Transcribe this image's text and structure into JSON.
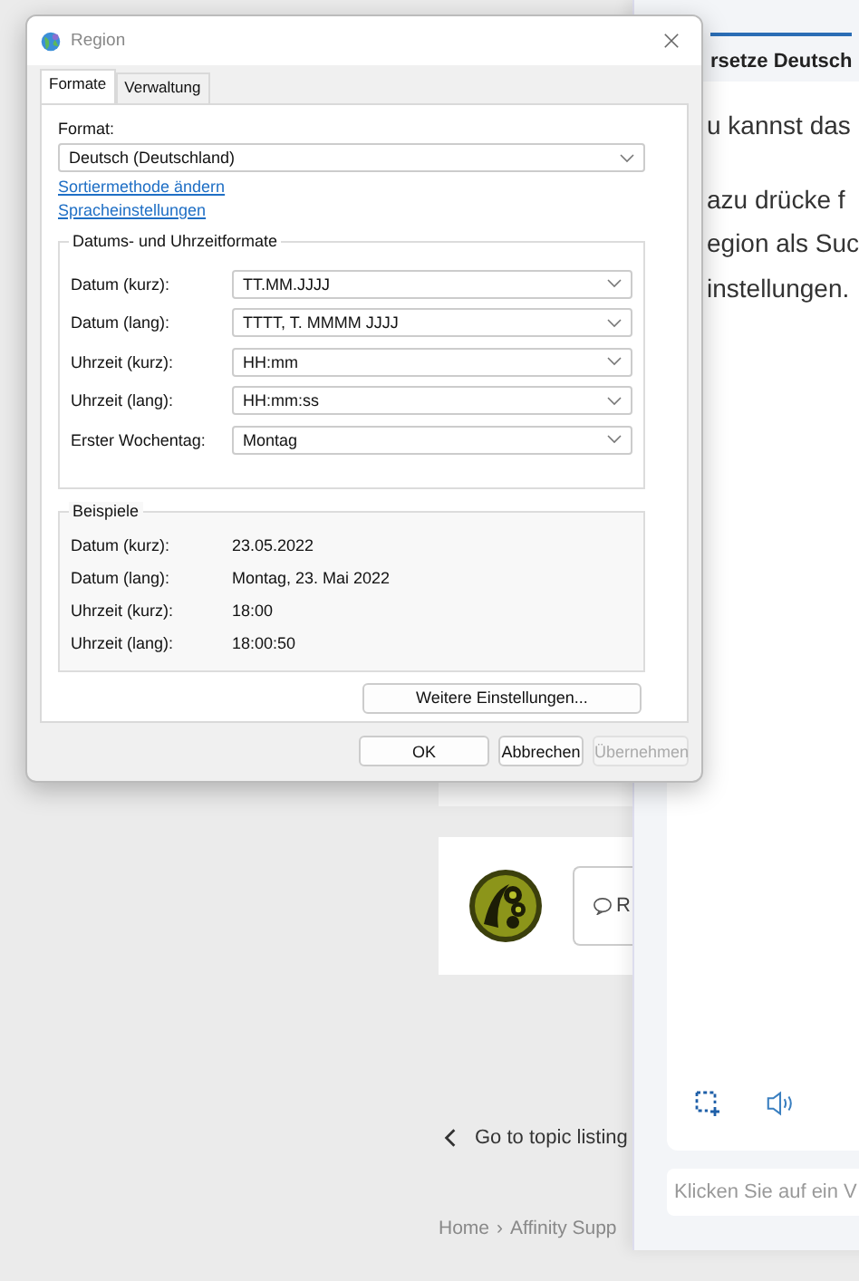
{
  "background_page": {
    "reply_label": "R",
    "back_link": "Go to topic listing",
    "breadcrumb": {
      "items": [
        "Home",
        "Affinity Supp"
      ],
      "separator": "›"
    }
  },
  "translator_panel": {
    "tab_label": "rsetze Deutsch",
    "paragraphs": [
      [
        "u kannst das"
      ],
      [
        "azu drücke f",
        "egion als Suc",
        "instellungen."
      ]
    ],
    "input": {
      "placeholder": "Klicken Sie auf ein V"
    }
  },
  "dialog": {
    "title": "Region",
    "tabs": [
      {
        "label": "Formate",
        "selected": true
      },
      {
        "label": "Verwaltung",
        "selected": false
      }
    ],
    "format_label": "Format:",
    "format_value": "Deutsch (Deutschland)",
    "links": [
      "Sortiermethode ändern",
      "Spracheinstellungen"
    ],
    "formats_group": {
      "title": "Datums- und Uhrzeitformate",
      "rows": [
        {
          "label": "Datum (kurz):",
          "value": "TT.MM.JJJJ"
        },
        {
          "label": "Datum (lang):",
          "value": "TTTT, T. MMMM JJJJ"
        },
        {
          "label": "Uhrzeit (kurz):",
          "value": "HH:mm"
        },
        {
          "label": "Uhrzeit (lang):",
          "value": "HH:mm:ss"
        },
        {
          "label": "Erster Wochentag:",
          "value": "Montag"
        }
      ]
    },
    "examples_group": {
      "title": "Beispiele",
      "rows": [
        {
          "label": "Datum (kurz):",
          "value": "23.05.2022"
        },
        {
          "label": "Datum (lang):",
          "value": "Montag, 23. Mai 2022"
        },
        {
          "label": "Uhrzeit (kurz):",
          "value": "18:00"
        },
        {
          "label": "Uhrzeit (lang):",
          "value": "18:00:50"
        }
      ]
    },
    "more_button": "Weitere Einstellungen...",
    "buttons": [
      {
        "label": "OK",
        "disabled": false
      },
      {
        "label": "Abbrechen",
        "disabled": false
      },
      {
        "label": "Übernehmen",
        "disabled": true
      }
    ]
  }
}
